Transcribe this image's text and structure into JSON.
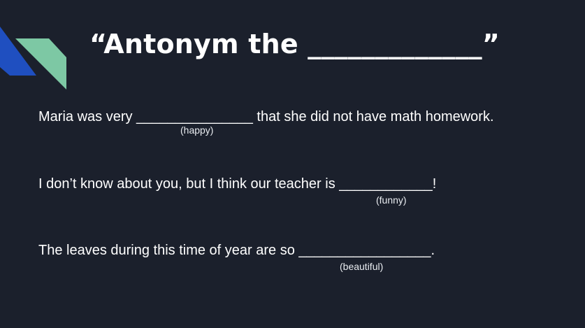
{
  "slide": {
    "title": "“Antonym the _____________”",
    "sentences": [
      {
        "text": "Maria was very _______________  that she did not have math homework.",
        "hint": "(happy)"
      },
      {
        "text": "I don’t know about you, but I think our teacher is ____________!",
        "hint": "(funny)"
      },
      {
        "text": "The leaves during this time of year are so _________________.",
        "hint": "(beautiful)"
      }
    ]
  },
  "colors": {
    "background": "#1b202c",
    "deco_blue": "#1f4fc0",
    "deco_green": "#7dc8a4",
    "text": "#ffffff"
  }
}
